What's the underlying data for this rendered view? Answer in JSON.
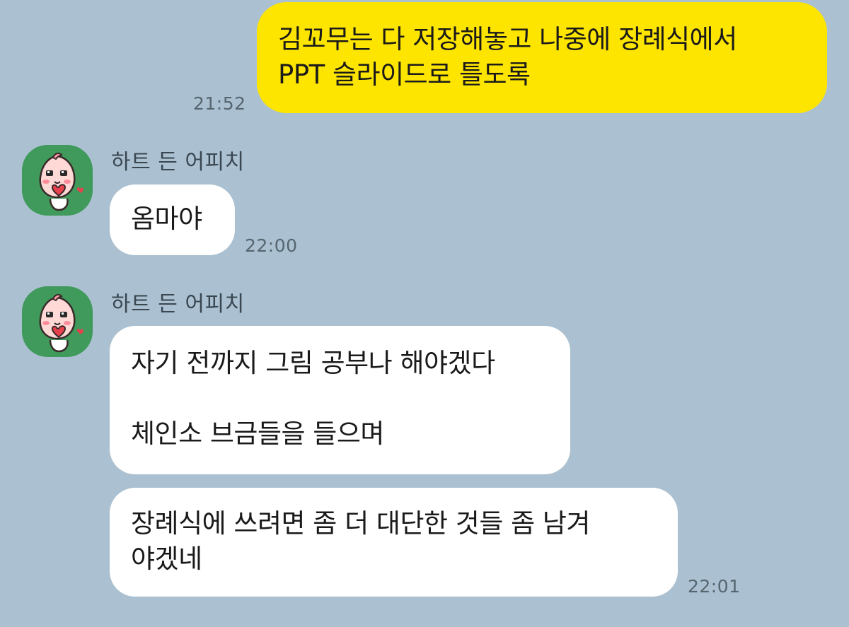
{
  "colors": {
    "background": "#abc1d1",
    "my_bubble": "#fee500",
    "their_bubble": "#ffffff",
    "avatar_bg": "#3f9a5b"
  },
  "messages": [
    {
      "from": "me",
      "lines": [
        "김꼬무는 다 저장해놓고 나중에 장례식에서",
        "PPT 슬라이드로 틀도록"
      ],
      "time": "21:52"
    },
    {
      "from": "other",
      "sender": "하트 든 어피치",
      "avatar_icon": "apeach-heart-icon",
      "lines": [
        "옴마야"
      ],
      "time": "22:00"
    },
    {
      "from": "other",
      "sender": "하트 든 어피치",
      "avatar_icon": "apeach-heart-icon",
      "lines": [
        "자기 전까지 그림 공부나 해야겠다",
        "",
        "체인소 브금들을 들으며"
      ],
      "time": ""
    },
    {
      "from": "other",
      "lines": [
        "장례식에 쓰려면 좀 더 대단한 것들 좀 남겨",
        "야겠네"
      ],
      "time": "22:01"
    }
  ]
}
